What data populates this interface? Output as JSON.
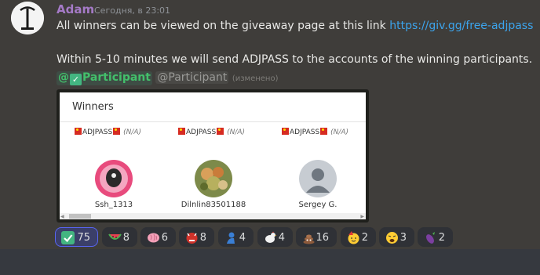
{
  "author": {
    "name": "Adam",
    "timestamp": "Сегодня, в 23:01"
  },
  "message": {
    "line1_text": "All winners can be viewed on the giveaway page at this link ",
    "line1_link": "https://giv.gg/free-adjpass",
    "line2": "Within 5-10 minutes we will send ADJPASS to the accounts of the winning participants.",
    "mention_role": "@",
    "mention_role_name": "Participant",
    "mention_plain": "@Participant",
    "edited": "(изменено)"
  },
  "embed": {
    "title": "Winners",
    "prizes": [
      {
        "name": "ADJPASS",
        "note": "(N/A)"
      },
      {
        "name": "ADJPASS",
        "note": "(N/A)"
      },
      {
        "name": "ADJPASS",
        "note": "(N/A)"
      }
    ],
    "winners": [
      "Ssh_1313",
      "Dilnlin83501188",
      "Sergey G."
    ]
  },
  "reactions": [
    {
      "emoji": "check-mark",
      "count": "75",
      "active": true
    },
    {
      "emoji": "watermelon",
      "count": "8"
    },
    {
      "emoji": "brain",
      "count": "6"
    },
    {
      "emoji": "ogre-mask",
      "count": "8"
    },
    {
      "emoji": "person-blue",
      "count": "4"
    },
    {
      "emoji": "chicken",
      "count": "4"
    },
    {
      "emoji": "poop",
      "count": "16"
    },
    {
      "emoji": "partying-face",
      "count": "2"
    },
    {
      "emoji": "weary-face",
      "count": "3"
    },
    {
      "emoji": "eggplant",
      "count": "2"
    }
  ],
  "colors": {
    "author": "#a57ac7",
    "link": "#3ca4ec",
    "mention": "#43c06b",
    "active_reaction": "#5865f2"
  }
}
